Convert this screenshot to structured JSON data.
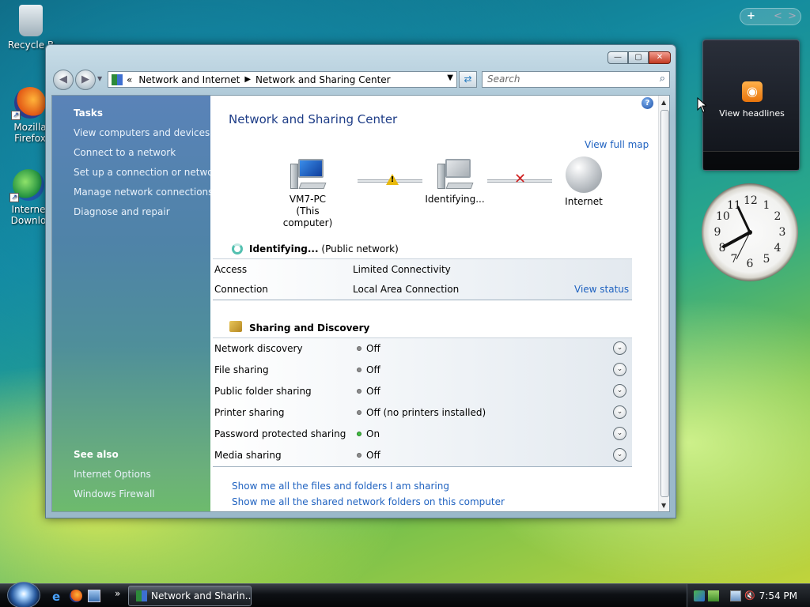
{
  "desktop": {
    "icons": [
      {
        "label": "Recycle B",
        "icon": "recycle-bin-icon"
      },
      {
        "label": "Mozilla\nFirefox",
        "line1": "Mozilla",
        "line2": "Firefox",
        "icon": "firefox-icon"
      },
      {
        "line1": "Interne",
        "line2": "Downlo",
        "icon": "download-manager-icon"
      }
    ]
  },
  "gadgets": {
    "feed_label": "View headlines",
    "clock_numbers": [
      "12",
      "1",
      "2",
      "3",
      "4",
      "5",
      "6",
      "7",
      "8",
      "9",
      "10",
      "11"
    ],
    "sidebar_controls": [
      "+",
      "<",
      ">"
    ]
  },
  "window": {
    "buttons": {
      "minimize": "—",
      "maximize": "▢",
      "close": "✕"
    },
    "address": {
      "prefix": "«",
      "crumbs": [
        "Network and Internet",
        "Network and Sharing Center"
      ]
    },
    "search_placeholder": "Search",
    "left_pane": {
      "tasks_header": "Tasks",
      "tasks": [
        "View computers and devices",
        "Connect to a network",
        "Set up a connection or network",
        "Manage network connections",
        "Diagnose and repair"
      ],
      "see_also_header": "See also",
      "see_also": [
        "Internet Options",
        "Windows Firewall"
      ]
    },
    "content": {
      "title": "Network and Sharing Center",
      "view_full_map": "View full map",
      "map": {
        "computer": {
          "line1": "VM7-PC",
          "line2": "(This computer)"
        },
        "network": "Identifying...",
        "internet": "Internet"
      },
      "network_status": {
        "name": "Identifying...",
        "type": "(Public network)",
        "rows": [
          {
            "key": "Access",
            "value": "Limited Connectivity"
          },
          {
            "key": "Connection",
            "value": "Local Area Connection",
            "link": "View status"
          }
        ]
      },
      "sharing": {
        "title": "Sharing and Discovery",
        "rows": [
          {
            "key": "Network discovery",
            "value": "Off",
            "on": false
          },
          {
            "key": "File sharing",
            "value": "Off",
            "on": false
          },
          {
            "key": "Public folder sharing",
            "value": "Off",
            "on": false
          },
          {
            "key": "Printer sharing",
            "value": "Off (no printers installed)",
            "on": false
          },
          {
            "key": "Password protected sharing",
            "value": "On",
            "on": true
          },
          {
            "key": "Media sharing",
            "value": "Off",
            "on": false
          }
        ]
      },
      "links": [
        "Show me all the files and folders I am sharing",
        "Show me all the shared network folders on this computer"
      ]
    }
  },
  "taskbar": {
    "task_button": "Network and Sharin...",
    "chevron": "»",
    "clock": "7:54 PM"
  },
  "colors": {
    "link": "#1f62c0",
    "title": "#1e3d87",
    "status_on": "#3fbf3f",
    "status_off": "#8c8c8c"
  }
}
